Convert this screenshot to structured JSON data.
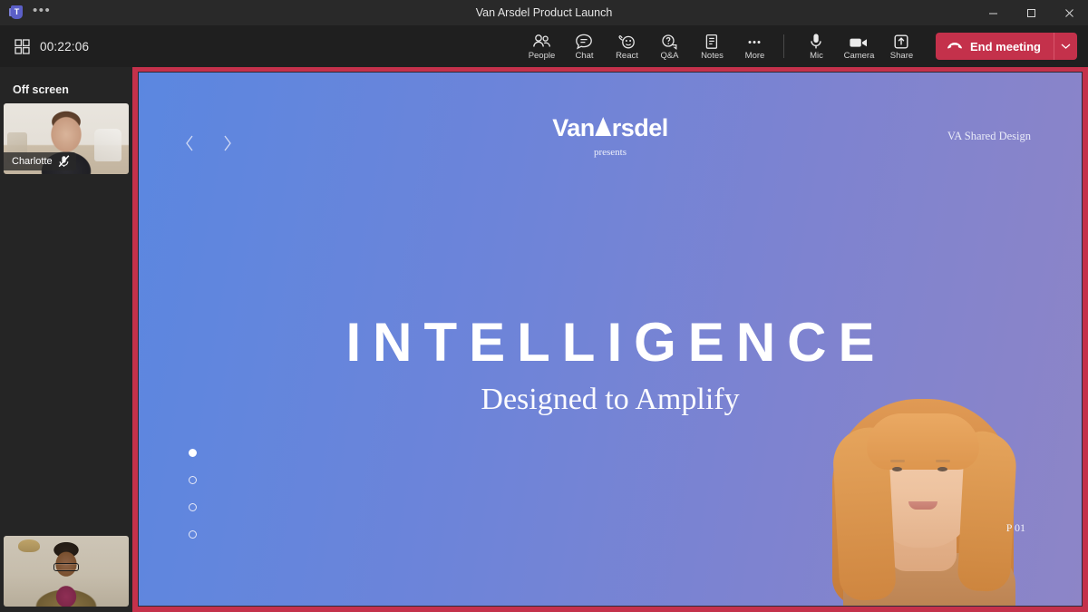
{
  "titlebar": {
    "app_logo": "teams-logo",
    "overflow": "•••",
    "title": "Van Arsdel Product Launch",
    "minimize_label": "Minimize",
    "maximize_label": "Maximize",
    "close_label": "Close"
  },
  "toolbar": {
    "layout_icon": "grid-view-icon",
    "timer": "00:22:06",
    "controls": [
      {
        "label": "People",
        "icon": "people-icon"
      },
      {
        "label": "Chat",
        "icon": "chat-icon"
      },
      {
        "label": "React",
        "icon": "react-icon"
      },
      {
        "label": "Q&A",
        "icon": "qanda-icon"
      },
      {
        "label": "Notes",
        "icon": "notes-icon"
      },
      {
        "label": "More",
        "icon": "more-icon"
      }
    ],
    "device_controls": [
      {
        "label": "Mic",
        "icon": "microphone-icon"
      },
      {
        "label": "Camera",
        "icon": "camera-icon"
      },
      {
        "label": "Share",
        "icon": "share-icon"
      }
    ],
    "end_meeting_label": "End meeting",
    "end_meeting_color": "#c4314b",
    "end_meeting_caret": "⌄"
  },
  "rail": {
    "section_title": "Off screen",
    "participants": [
      {
        "name": "Charlotte",
        "muted": true
      },
      {
        "name": "",
        "muted": false
      }
    ]
  },
  "share": {
    "border_color": "#c4314b",
    "gradient_from": "#5b87e0",
    "gradient_to": "#8d85c7",
    "prev_label": "‹",
    "next_label": "›",
    "logo_part1": "Van",
    "logo_part2": "rsdel",
    "logo_sub": "presents",
    "corner_label": "VA Shared Design",
    "headline": "INTELLIGENCE",
    "subhead": "Designed to Amplify",
    "page_number": "P 01",
    "slide_dots": 4,
    "active_dot": 0
  }
}
